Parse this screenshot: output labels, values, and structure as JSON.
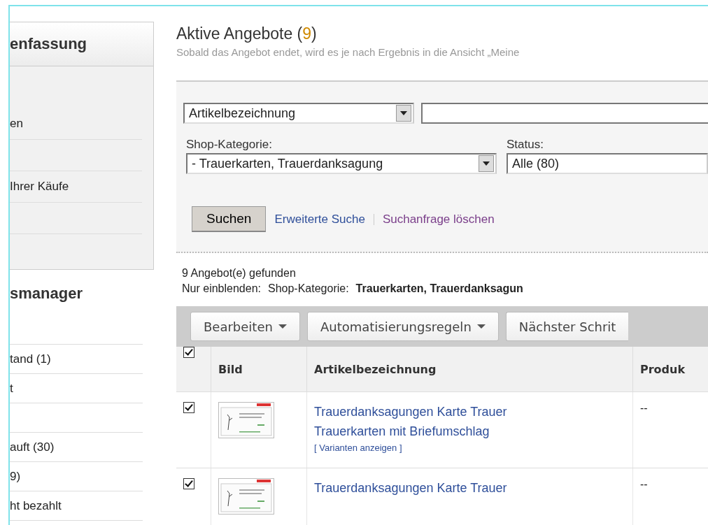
{
  "sidebar": {
    "summary_heading": "enfassung",
    "summary_items": [
      {
        "label": "en"
      },
      {
        "label": "Ihrer Käufe"
      }
    ],
    "manager_heading": "smanager",
    "manager_items": [
      {
        "label": "tand (1)"
      },
      {
        "label": "t"
      },
      {
        "label": "auft (30)"
      },
      {
        "label": "9)"
      },
      {
        "label": "ht bezahlt"
      }
    ]
  },
  "page": {
    "title": "Aktive Angebote",
    "count_open": "(",
    "count": "9",
    "count_close": ")",
    "subtitle": "Sobald das Angebot endet, wird es je nach Ergebnis in die Ansicht „Meine"
  },
  "filter": {
    "field_select": "Artikelbezeichnung",
    "shop_label": "Shop-Kategorie:",
    "shop_select": "- Trauerkarten, Trauerdanksagung",
    "status_label": "Status:",
    "status_select": "Alle (80)",
    "search_button": "Suchen",
    "advanced_link": "Erweiterte Suche",
    "clear_link": "Suchanfrage löschen"
  },
  "results": {
    "found_count": "9",
    "found_text": "Angebot(e) gefunden",
    "only_label": "Nur einblenden:",
    "category_label": "Shop-Kategorie:",
    "category_value": "Trauerkarten, Trauerdanksagun"
  },
  "toolbar": [
    {
      "label": "Bearbeiten",
      "dropdown": true
    },
    {
      "label": "Automatisierungsregeln",
      "dropdown": true
    },
    {
      "label": "Nächster Schrit",
      "dropdown": false
    }
  ],
  "table": {
    "header_checked": true,
    "columns": [
      "Bild",
      "Artikelbezeichnung",
      "Produk"
    ],
    "rows": [
      {
        "checked": true,
        "title_lines": [
          "Trauerdanksagungen Karte Trauer",
          "Trauerkarten mit Briefumschlag"
        ],
        "variants_link": "[ Varianten anzeigen ]",
        "column_3": "--"
      },
      {
        "checked": true,
        "title_lines": [
          "Trauerdanksagungen Karte Trauer"
        ],
        "column_3": "--"
      }
    ]
  }
}
